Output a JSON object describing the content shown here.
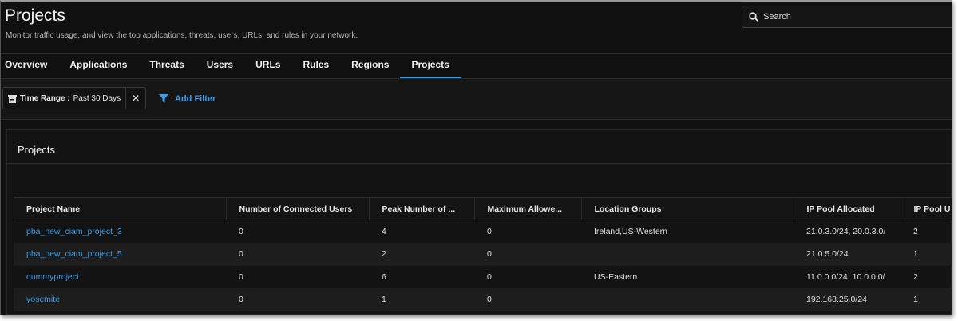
{
  "header": {
    "title": "Projects",
    "subtitle": "Monitor traffic usage, and view the top applications, threats, users, URLs, and rules in your network.",
    "search_placeholder": "Search"
  },
  "tabs": [
    {
      "label": "Overview"
    },
    {
      "label": "Applications"
    },
    {
      "label": "Threats"
    },
    {
      "label": "Users"
    },
    {
      "label": "URLs"
    },
    {
      "label": "Rules"
    },
    {
      "label": "Regions"
    },
    {
      "label": "Projects",
      "active": true
    }
  ],
  "filters": {
    "time_range_label": "Time Range :",
    "time_range_value": "Past 30 Days",
    "add_filter": "Add Filter"
  },
  "panel": {
    "title": "Projects"
  },
  "table": {
    "columns": [
      "Project Name",
      "Number of Connected Users",
      "Peak Number of ...",
      "Maximum Allowe...",
      "Location Groups",
      "IP Pool Allocated",
      "IP Pool U"
    ],
    "rows": [
      [
        "pba_new_ciam_project_3",
        "0",
        "4",
        "0",
        "Ireland,US-Western",
        "21.0.3.0/24, 20.0.3.0/",
        "2"
      ],
      [
        "pba_new_ciam_project_5",
        "0",
        "2",
        "0",
        "",
        "21.0.5.0/24",
        "1"
      ],
      [
        "dummyproject",
        "0",
        "6",
        "0",
        "US-Eastern",
        "11.0.0.0/24, 10.0.0.0/",
        "2"
      ],
      [
        "yosemite",
        "0",
        "1",
        "0",
        "",
        "192.168.25.0/24",
        "1"
      ]
    ]
  },
  "colors": {
    "accent": "#3a9be8",
    "background": "#101010"
  }
}
